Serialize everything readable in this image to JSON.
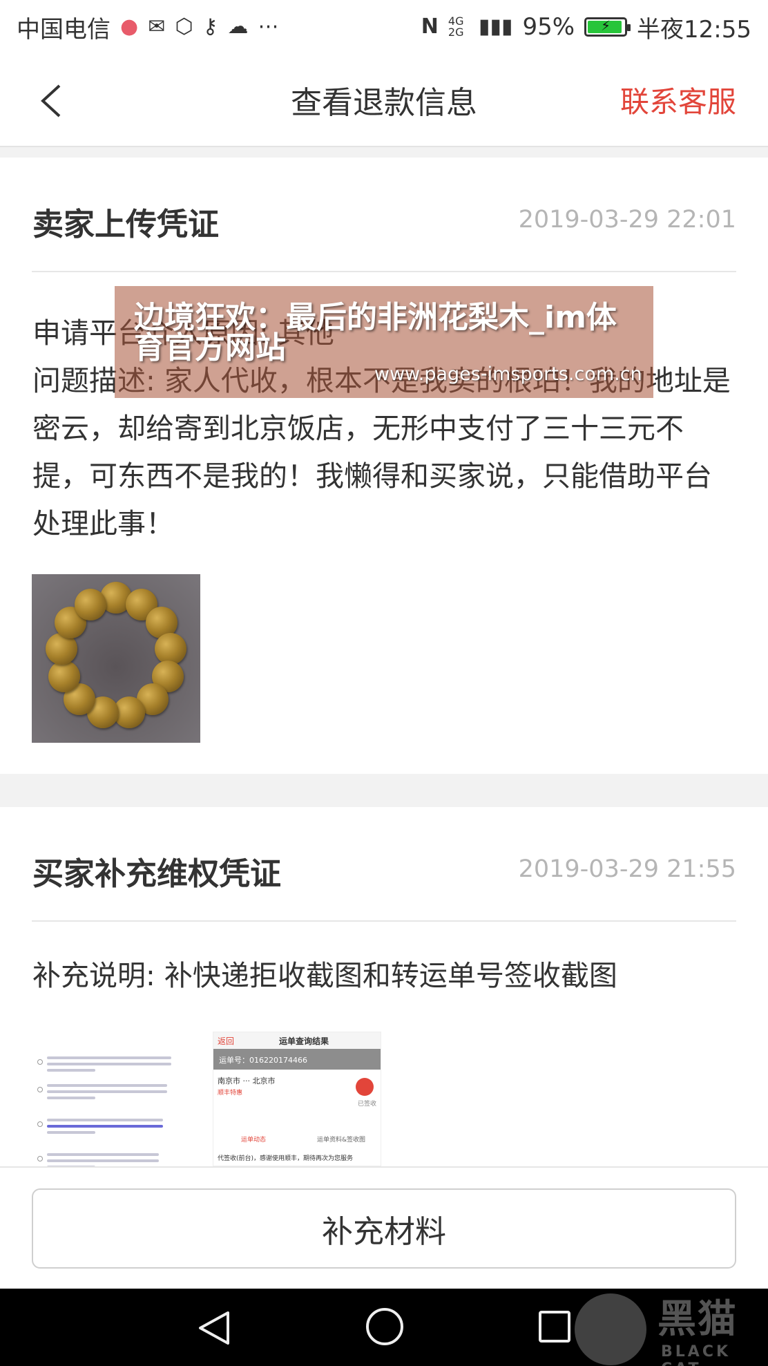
{
  "status_bar": {
    "carrier": "中国电信",
    "battery_percent": "95%",
    "battery_level": 0.95,
    "network": "4G 2G",
    "time": "半夜12:55",
    "icons": [
      "pig-icon",
      "mail-icon",
      "hexagon-icon",
      "key-icon",
      "cloud-icon",
      "more-icon",
      "nfc-icon",
      "signal-icon",
      "battery-icon"
    ]
  },
  "header": {
    "title": "查看退款信息",
    "contact_label": "联系客服",
    "accent_color": "#e2453a"
  },
  "seller_card": {
    "title": "卖家上传凭证",
    "time": "2019-03-29 22:01",
    "body": "申请平台介入原因: 其他\n问题描述: 家人代收，根本不是我卖的根珀！我的地址是密云，却给寄到北京饭店，无形中支付了三十三元不提，可东西不是我的！我懒得和买家说，只能借助平台处理此事！"
  },
  "buyer_card": {
    "title": "买家补充维权凭证",
    "time": "2019-03-29 21:55",
    "body": "补充说明: 补快递拒收截图和转运单号签收截图"
  },
  "thumbnail2": {
    "back": "返回",
    "title": "运单查询结果",
    "order_no": "运单号：016220174466",
    "route": "南京市 ··· 北京市",
    "tag": "顺丰特惠",
    "status": "已签收",
    "tab1": "运单动态",
    "tab2": "运单资料&签收图",
    "footer": "代签收(前台)，感谢使用顺丰，期待再次为您服务"
  },
  "action": {
    "supplement_button": "补充材料"
  },
  "watermark": {
    "banner": "边境狂欢：最后的非洲花梨木_im体育官方网站",
    "url": "www.pages-imsports.com.cn",
    "brand_cn": "黑猫",
    "brand_en": "BLACK CAT"
  }
}
